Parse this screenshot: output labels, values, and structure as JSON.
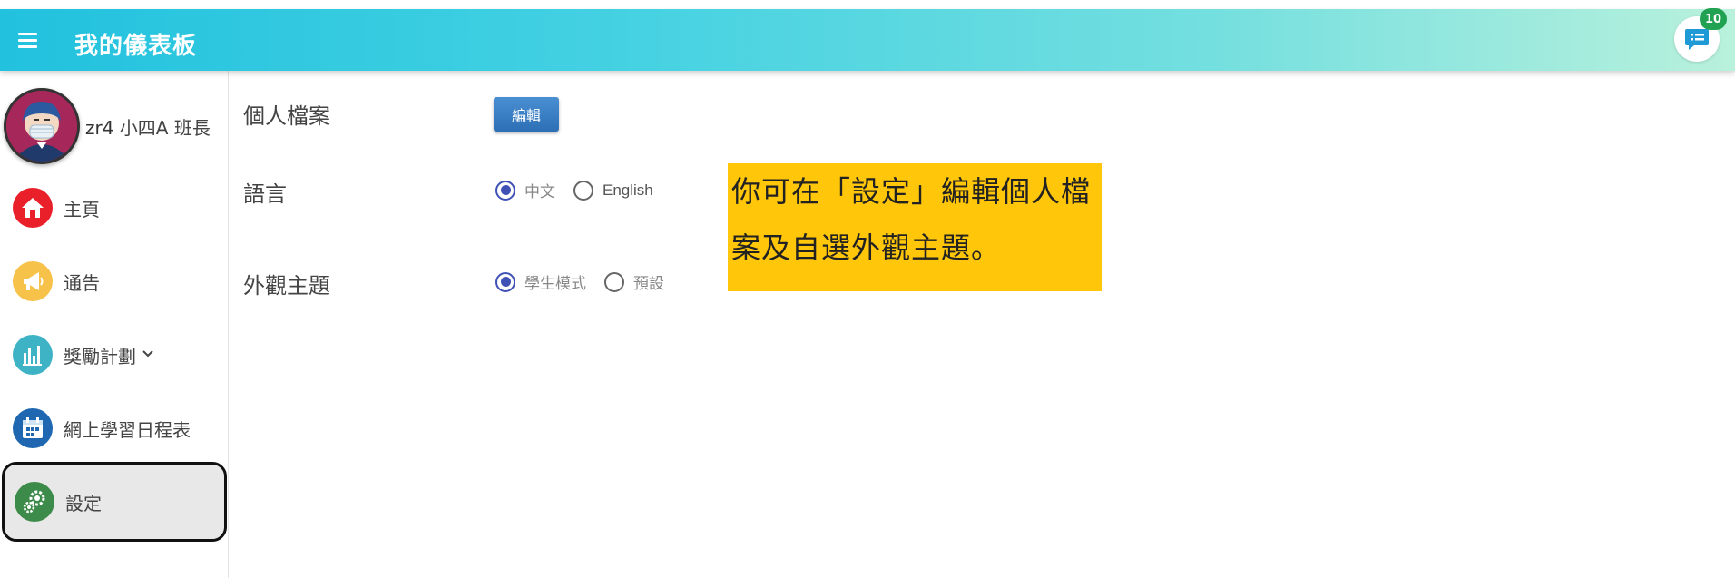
{
  "header": {
    "title": "我的儀表板",
    "menu_icon": "hamburger-icon",
    "chat_icon": "chat-list-icon",
    "chat_badge": "10"
  },
  "profile": {
    "username": "zr4",
    "class_role": "小四A 班長"
  },
  "sidebar": {
    "items": [
      {
        "label": "主頁",
        "icon": "home-icon"
      },
      {
        "label": "通告",
        "icon": "megaphone-icon"
      },
      {
        "label": "獎勵計劃",
        "icon": "bar-chart-icon",
        "has_dropdown": true
      },
      {
        "label": "網上學習日程表",
        "icon": "calendar-icon"
      },
      {
        "label": "設定",
        "icon": "settings-gears-icon",
        "active": true
      }
    ]
  },
  "settings": {
    "profile_label": "個人檔案",
    "edit_button": "編輯",
    "language_label": "語言",
    "language_options": [
      {
        "label": "中文",
        "checked": true
      },
      {
        "label": "English",
        "checked": false
      }
    ],
    "theme_label": "外觀主題",
    "theme_options": [
      {
        "label": "學生模式",
        "checked": true
      },
      {
        "label": "預設",
        "checked": false
      }
    ]
  },
  "tip": {
    "text": "你可在「設定」編輯個人檔案及自選外觀主題。"
  },
  "colors": {
    "header_start": "#22c1de",
    "header_end": "#b9f1dc",
    "badge": "#21a152",
    "edit_button": "#2c6fb5",
    "radio_checked": "#3f51b5",
    "tip_background": "#ffc60a"
  }
}
